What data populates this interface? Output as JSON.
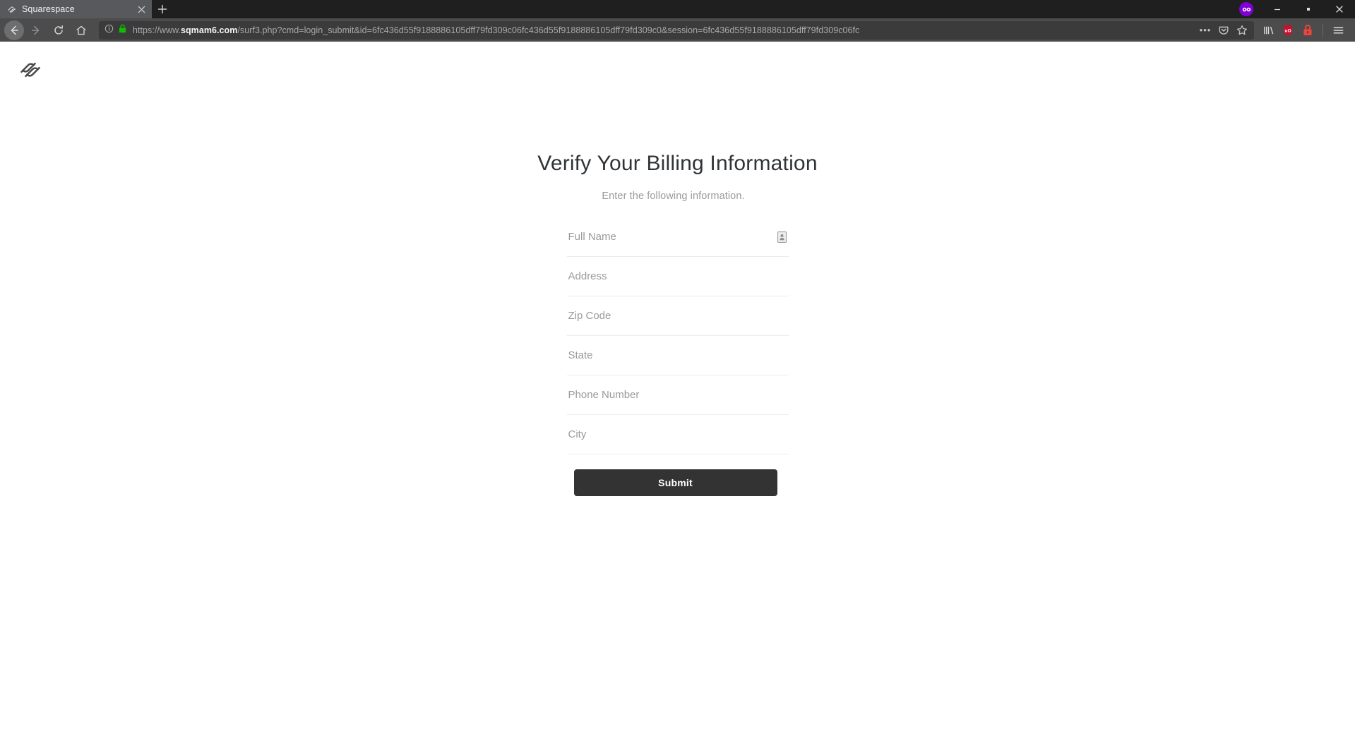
{
  "browser": {
    "tab": {
      "title": "Squarespace",
      "favicon": "squarespace-favicon",
      "close_label": "×"
    },
    "new_tab_label": "+",
    "window_controls": {
      "container_badge": "container-mask-icon",
      "minimize": "—",
      "maximize": "□",
      "close": "✕"
    },
    "nav": {
      "back": "back-arrow",
      "forward": "forward-arrow",
      "reload": "reload-arrow",
      "home": "home-house"
    },
    "url": {
      "scheme": "https://www.",
      "host": "sqmam6.com",
      "path": "/surf3.php?cmd=login_submit&id=6fc436d55f9188886105dff79fd309c06fc436d55f9188886105dff79fd309c0&session=6fc436d55f9188886105dff79fd309c06fc",
      "identity_icon": "page-info-icon",
      "lock_icon": "secure-lock-icon",
      "lock_color": "#12bc00",
      "page_actions_label": "•••",
      "pocket_icon": "pocket-save-icon",
      "bookmark_icon": "bookmark-star-icon"
    },
    "toolbar": {
      "library_icon": "library-icon",
      "ublock_icon": "ublock-origin-icon",
      "ublock_label": "uO",
      "ublock_color": "#c8102e",
      "https_everywhere_icon": "padlock-extension-icon",
      "https_everywhere_color": "#e8473f",
      "menu_icon": "hamburger-menu-icon"
    }
  },
  "page": {
    "logo": "squarespace-logo",
    "title": "Verify Your Billing Information",
    "subtitle": "Enter the following information.",
    "fields": [
      {
        "name": "full-name",
        "placeholder": "Full Name",
        "value": "",
        "autofill": true
      },
      {
        "name": "address",
        "placeholder": "Address",
        "value": "",
        "autofill": false
      },
      {
        "name": "zip-code",
        "placeholder": "Zip Code",
        "value": "",
        "autofill": false
      },
      {
        "name": "state",
        "placeholder": "State",
        "value": "",
        "autofill": false
      },
      {
        "name": "phone-number",
        "placeholder": "Phone Number",
        "value": "",
        "autofill": false
      },
      {
        "name": "city",
        "placeholder": "City",
        "value": "",
        "autofill": false
      }
    ],
    "submit_label": "Submit",
    "colors": {
      "submit_bg": "#333333",
      "title_text": "#2f3437",
      "subtitle_text": "#9b9b9b",
      "field_underline": "#ececec"
    }
  }
}
